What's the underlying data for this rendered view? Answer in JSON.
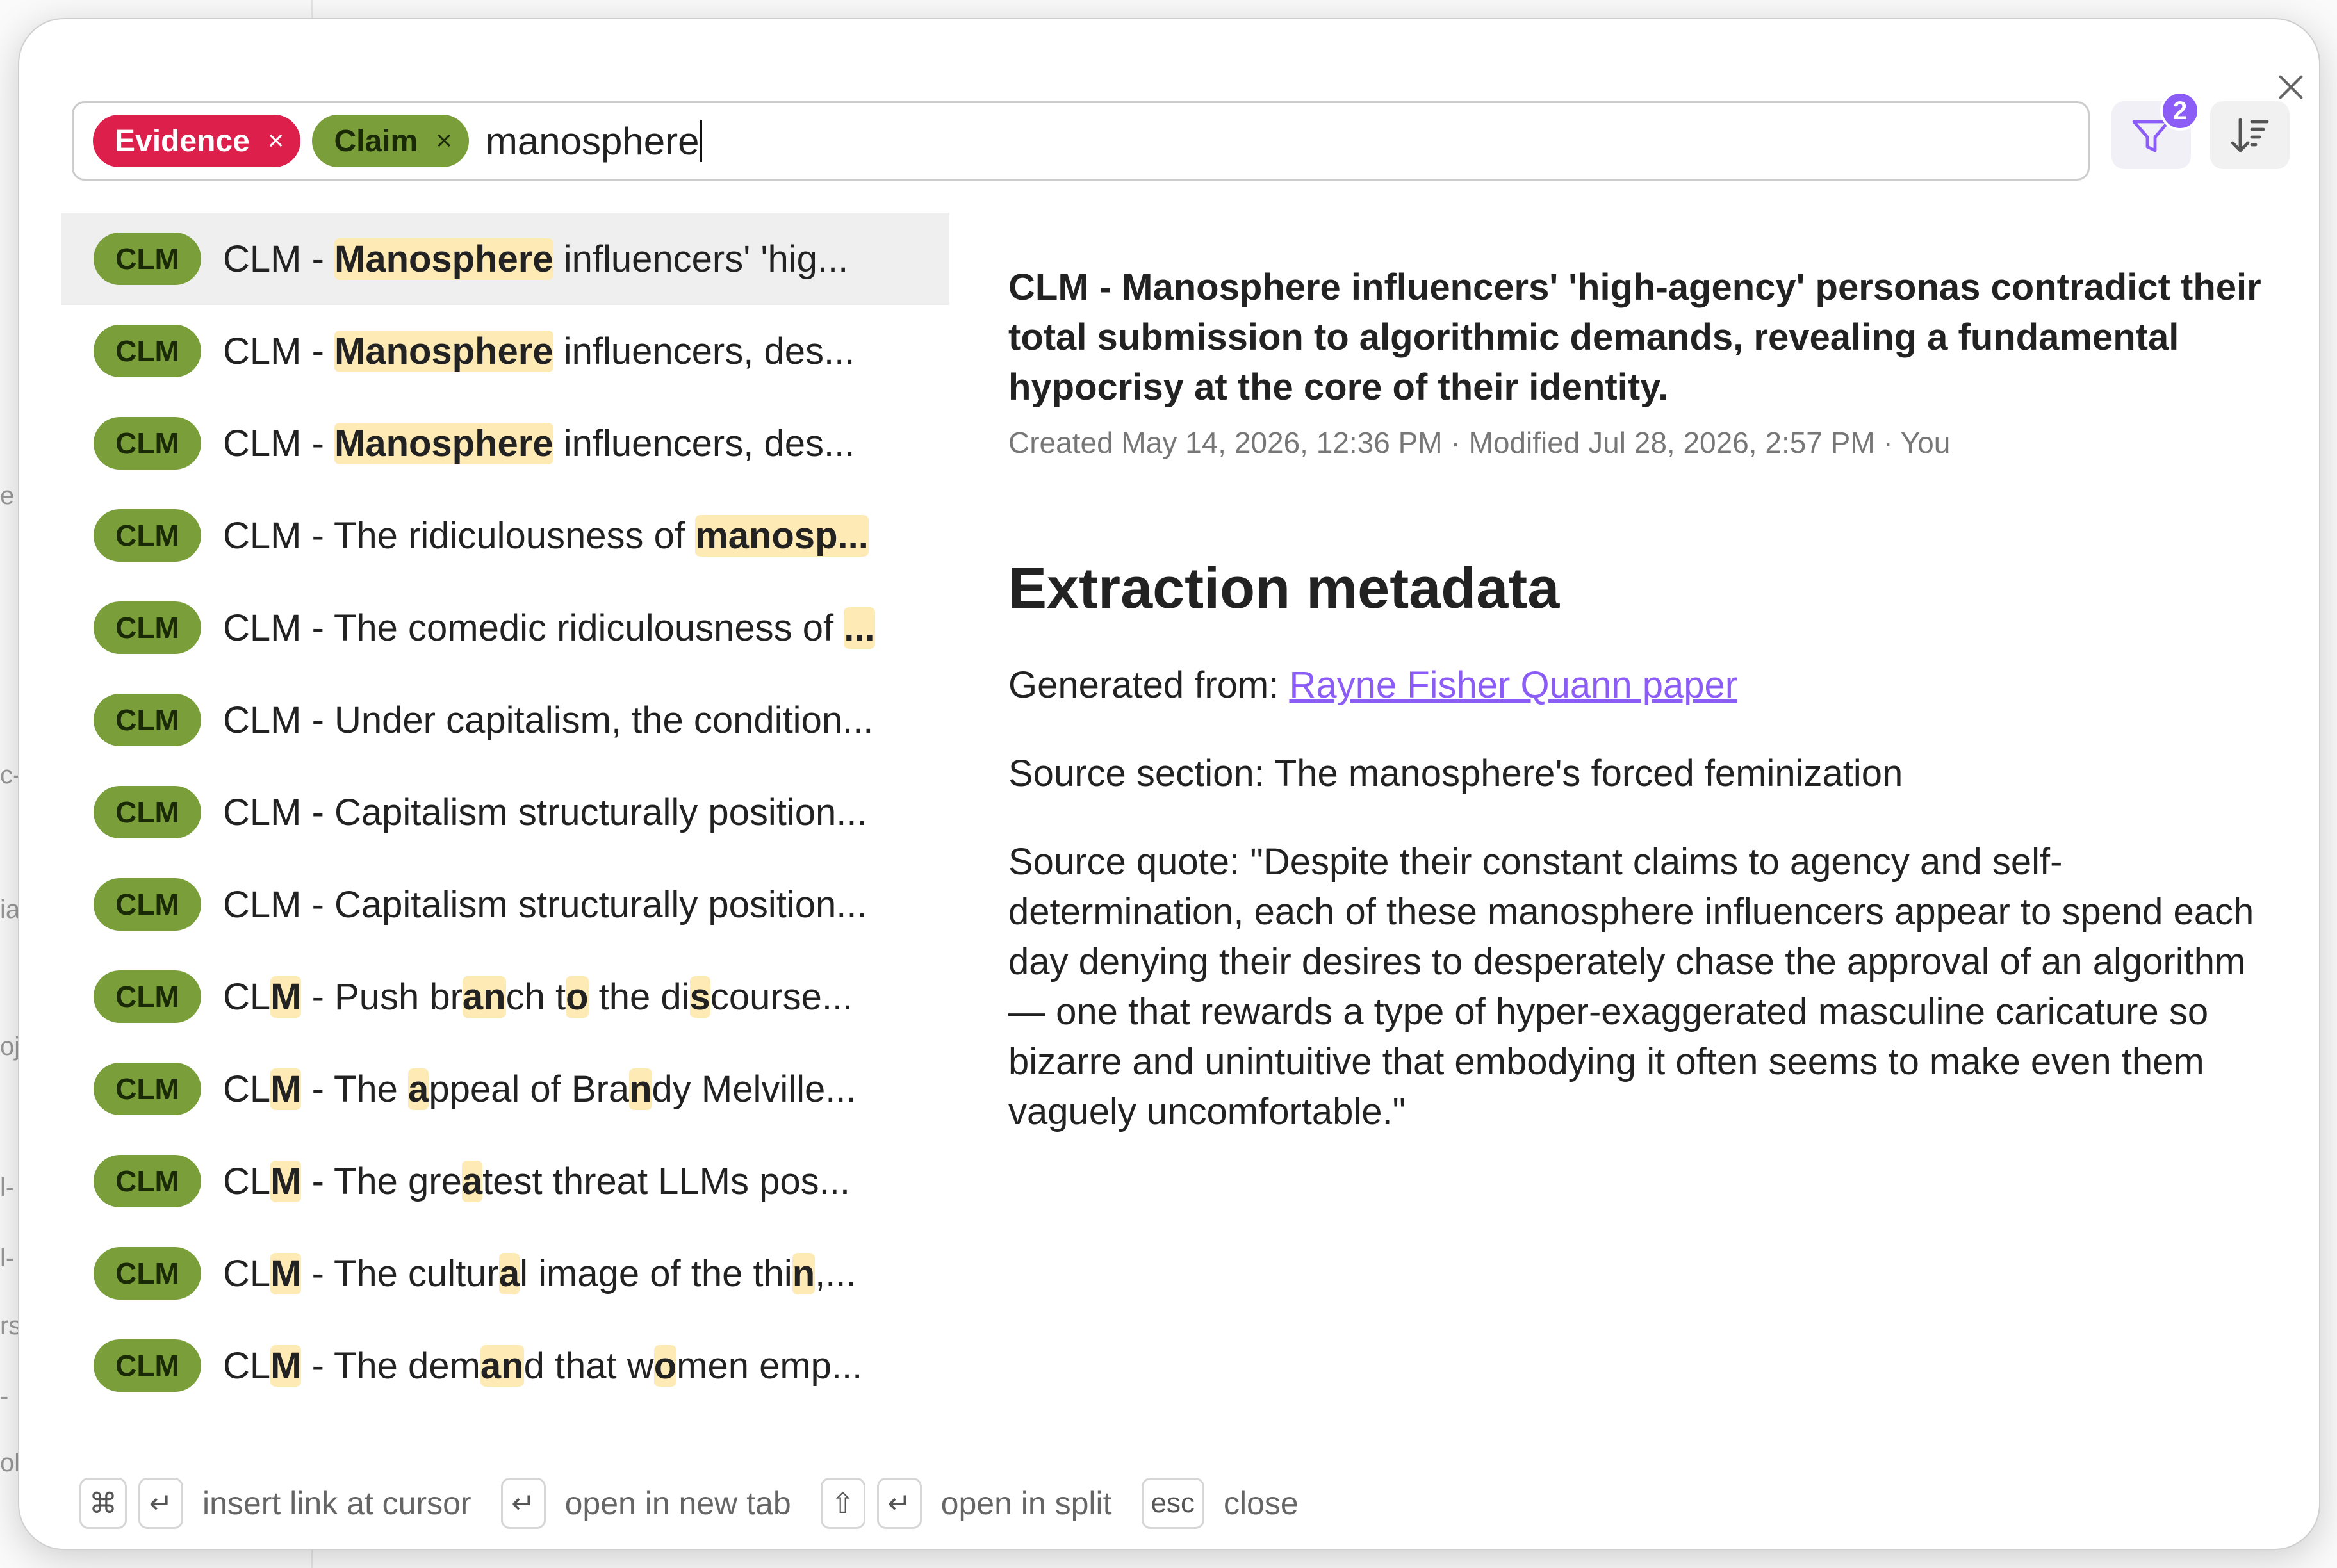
{
  "filters": {
    "chips": [
      {
        "label": "Evidence",
        "color": "#dc1f4b"
      },
      {
        "label": "Claim",
        "color": "#7a9e3a"
      }
    ],
    "chip_remove": "×",
    "query": "manosphere",
    "active_filter_count": "2"
  },
  "results": [
    {
      "badge": "CLM",
      "segments": [
        {
          "t": "CLM - "
        },
        {
          "t": "Manosphere",
          "h": true
        },
        {
          "t": " influencers' 'hig..."
        }
      ],
      "selected": true
    },
    {
      "badge": "CLM",
      "segments": [
        {
          "t": "CLM - "
        },
        {
          "t": "Manosphere",
          "h": true
        },
        {
          "t": " influencers, des..."
        }
      ]
    },
    {
      "badge": "CLM",
      "segments": [
        {
          "t": "CLM - "
        },
        {
          "t": "Manosphere",
          "h": true
        },
        {
          "t": " influencers, des..."
        }
      ]
    },
    {
      "badge": "CLM",
      "segments": [
        {
          "t": "CLM - The ridiculousness of "
        },
        {
          "t": "manosp...",
          "h": true
        }
      ]
    },
    {
      "badge": "CLM",
      "segments": [
        {
          "t": "CLM - The comedic ridiculousness of "
        },
        {
          "t": "...",
          "h": true
        }
      ]
    },
    {
      "badge": "CLM",
      "segments": [
        {
          "t": "CLM - Under capitalism, the condition..."
        }
      ]
    },
    {
      "badge": "CLM",
      "segments": [
        {
          "t": "CLM - Capitalism structurally position..."
        }
      ]
    },
    {
      "badge": "CLM",
      "segments": [
        {
          "t": "CLM - Capitalism structurally position..."
        }
      ]
    },
    {
      "badge": "CLM",
      "segments": [
        {
          "t": "CL"
        },
        {
          "t": "M",
          "h": true
        },
        {
          "t": " - Push br"
        },
        {
          "t": "an",
          "h": true
        },
        {
          "t": "ch t"
        },
        {
          "t": "o",
          "h": true
        },
        {
          "t": " the di"
        },
        {
          "t": "s",
          "h": true
        },
        {
          "t": "course..."
        }
      ]
    },
    {
      "badge": "CLM",
      "segments": [
        {
          "t": "CL"
        },
        {
          "t": "M",
          "h": true
        },
        {
          "t": " - The "
        },
        {
          "t": "a",
          "h": true
        },
        {
          "t": "ppeal of Bra"
        },
        {
          "t": "n",
          "h": true
        },
        {
          "t": "dy Melville..."
        }
      ]
    },
    {
      "badge": "CLM",
      "segments": [
        {
          "t": "CL"
        },
        {
          "t": "M",
          "h": true
        },
        {
          "t": " - The gre"
        },
        {
          "t": "a",
          "h": true
        },
        {
          "t": "test threat LLMs pos..."
        }
      ]
    },
    {
      "badge": "CLM",
      "segments": [
        {
          "t": "CL"
        },
        {
          "t": "M",
          "h": true
        },
        {
          "t": " - The cultur"
        },
        {
          "t": "a",
          "h": true
        },
        {
          "t": "l image of the thi"
        },
        {
          "t": "n",
          "h": true
        },
        {
          "t": ",..."
        }
      ]
    },
    {
      "badge": "CLM",
      "segments": [
        {
          "t": "CL"
        },
        {
          "t": "M",
          "h": true
        },
        {
          "t": " - The dem"
        },
        {
          "t": "an",
          "h": true
        },
        {
          "t": "d that w"
        },
        {
          "t": "o",
          "h": true
        },
        {
          "t": "men emp..."
        }
      ]
    }
  ],
  "preview": {
    "title": "CLM - Manosphere influencers' 'high-agency' personas contradict their total submission to algorithmic demands, revealing a fundamental hypocrisy at the core of their identity.",
    "meta": "Created May 14, 2026, 12:36 PM · Modified Jul 28, 2026, 2:57 PM · You",
    "section_heading": "Extraction metadata",
    "generated_label": "Generated from: ",
    "generated_link": "Rayne Fisher Quann paper",
    "source_section": "Source section: The manosphere's forced feminization",
    "source_quote": "Source quote: \"Despite their constant claims to agency and self-determination, each of these manosphere influencers appear to spend each day denying their desires to desperately chase the approval of an algorithm — one that rewards a type of hyper-exaggerated masculine caricature so bizarre and unintuitive that embodying it often seems to make even them vaguely uncomfortable.\""
  },
  "footer": {
    "cmd_key": "⌘",
    "enter_key": "↵",
    "shift_key": "⇧",
    "esc_key": "esc",
    "insert_link": "insert link at cursor",
    "open_new_tab": "open in new tab",
    "open_split": "open in split",
    "close": "close"
  },
  "background_fragments": [
    "e",
    "c-",
    "ia",
    "oj",
    "l-",
    "l-",
    "rs",
    "-",
    "ob"
  ],
  "colors": {
    "accent": "#8b5cf6",
    "evidence": "#dc1f4b",
    "claim": "#7a9e3a",
    "highlight": "#fdeab5"
  }
}
